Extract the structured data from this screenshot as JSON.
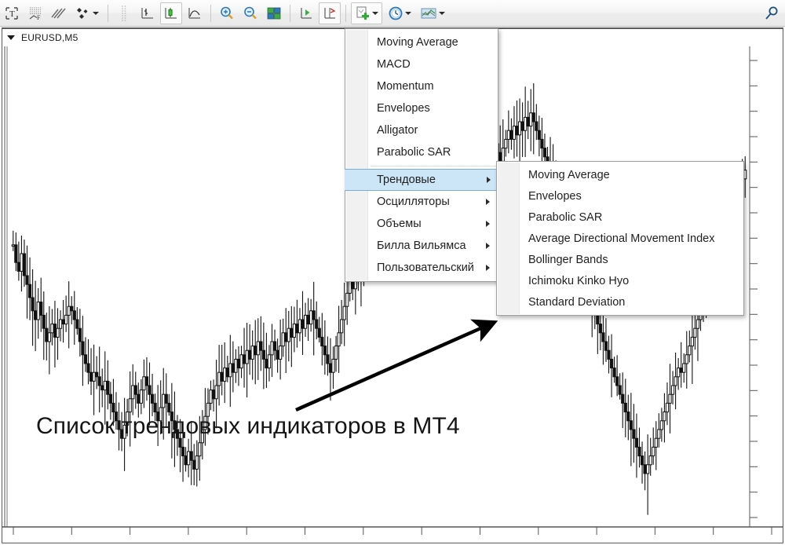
{
  "app": {
    "name": "MetaTrader 4",
    "accent": "#cde6f7",
    "accent_border": "#7aaed6",
    "toolbar_bg": "#eeeeee",
    "chart_bg": "#ffffff",
    "candle_color": "#111111"
  },
  "toolbar": {
    "groups": [
      {
        "name": "drawing-tools",
        "buttons": [
          {
            "icon": "crosshair-icon",
            "label": "Crosshair",
            "framed": false,
            "dropdown": false
          },
          {
            "icon": "fibonacci-icon",
            "label": "Fibonacci",
            "framed": false,
            "dropdown": false
          },
          {
            "icon": "trendline-channel-icon",
            "label": "Channels",
            "framed": false,
            "dropdown": false
          },
          {
            "icon": "shapes-icon",
            "label": "Shapes",
            "framed": false,
            "dropdown": true
          }
        ]
      },
      {
        "name": "chart-type-tools",
        "buttons": [
          {
            "icon": "bar-chart-icon",
            "label": "Bar Chart",
            "framed": false,
            "dropdown": false
          },
          {
            "icon": "candlestick-chart-icon",
            "label": "Candlesticks",
            "framed": true,
            "dropdown": false
          },
          {
            "icon": "line-chart-icon",
            "label": "Line Chart",
            "framed": false,
            "dropdown": false
          }
        ]
      },
      {
        "name": "zoom-tools",
        "buttons": [
          {
            "icon": "zoom-in-icon",
            "label": "Zoom In",
            "framed": false,
            "dropdown": false
          },
          {
            "icon": "zoom-out-icon",
            "label": "Zoom Out",
            "framed": false,
            "dropdown": false
          },
          {
            "icon": "tile-windows-icon",
            "label": "Tile Windows",
            "framed": false,
            "dropdown": false
          }
        ]
      },
      {
        "name": "scroll-tools",
        "buttons": [
          {
            "icon": "auto-scroll-icon",
            "label": "Auto Scroll",
            "framed": false,
            "dropdown": false
          },
          {
            "icon": "chart-shift-icon",
            "label": "Chart Shift",
            "framed": true,
            "dropdown": false
          }
        ]
      },
      {
        "name": "indicator-tools",
        "buttons": [
          {
            "icon": "add-indicator-icon",
            "label": "Indicators",
            "framed": true,
            "dropdown": true
          },
          {
            "icon": "timeframe-clock-icon",
            "label": "Periods",
            "framed": false,
            "dropdown": true
          },
          {
            "icon": "templates-icon",
            "label": "Templates",
            "framed": false,
            "dropdown": true
          }
        ]
      }
    ],
    "search_icon": "search-icon"
  },
  "chart": {
    "symbol_label": "EURUSD,M5",
    "dropdown_icon": "chevron-down-icon",
    "price_axis": {
      "ticks": 18
    },
    "time_axis": {
      "ticks": 13
    }
  },
  "annotation": {
    "text": "Список трендовых индикаторов в MT4",
    "arrow_icon": "arrow-pointer-icon"
  },
  "menus": {
    "indicators_menu": {
      "name": "indicators-dropdown",
      "items": [
        {
          "label": "Moving Average",
          "submenu": false,
          "highlighted": false,
          "separator_after": false
        },
        {
          "label": "MACD",
          "submenu": false,
          "highlighted": false,
          "separator_after": false
        },
        {
          "label": "Momentum",
          "submenu": false,
          "highlighted": false,
          "separator_after": false
        },
        {
          "label": "Envelopes",
          "submenu": false,
          "highlighted": false,
          "separator_after": false
        },
        {
          "label": "Alligator",
          "submenu": false,
          "highlighted": false,
          "separator_after": false
        },
        {
          "label": "Parabolic SAR",
          "submenu": false,
          "highlighted": false,
          "separator_after": true
        },
        {
          "label": "Трендовые",
          "submenu": true,
          "highlighted": true,
          "separator_after": false
        },
        {
          "label": "Осцилляторы",
          "submenu": true,
          "highlighted": false,
          "separator_after": false
        },
        {
          "label": "Объемы",
          "submenu": true,
          "highlighted": false,
          "separator_after": false
        },
        {
          "label": "Билла Вильямса",
          "submenu": true,
          "highlighted": false,
          "separator_after": false
        },
        {
          "label": "Пользовательский",
          "submenu": true,
          "highlighted": false,
          "separator_after": false
        }
      ]
    },
    "trend_submenu": {
      "name": "trend-indicators-submenu",
      "items": [
        {
          "label": "Moving Average"
        },
        {
          "label": "Envelopes"
        },
        {
          "label": "Parabolic SAR"
        },
        {
          "label": "Average Directional Movement Index"
        },
        {
          "label": "Bollinger Bands"
        },
        {
          "label": "Ichimoku Kinko Hyo"
        },
        {
          "label": "Standard Deviation"
        }
      ]
    }
  },
  "chart_data": {
    "type": "candlestick",
    "title": "EURUSD,M5",
    "xlabel": "",
    "ylabel": "",
    "grid": false,
    "legend": false,
    "series": [
      {
        "name": "EURUSD M5",
        "values": [
          62,
          58,
          56,
          60,
          55,
          53,
          50,
          47,
          45,
          49,
          46,
          43,
          40,
          42,
          44,
          41,
          43,
          45,
          44,
          46,
          48,
          47,
          45,
          43,
          40,
          37,
          35,
          33,
          31,
          33,
          32,
          30,
          29,
          31,
          28,
          26,
          24,
          22,
          20,
          18,
          21,
          24,
          27,
          30,
          28,
          26,
          29,
          32,
          30,
          28,
          26,
          24,
          22,
          25,
          28,
          26,
          24,
          22,
          20,
          18,
          16,
          14,
          12,
          15,
          13,
          11,
          14,
          17,
          20,
          23,
          26,
          29,
          27,
          30,
          33,
          31,
          34,
          32,
          35,
          33,
          36,
          34,
          37,
          35,
          38,
          36,
          39,
          37,
          40,
          38,
          36,
          34,
          37,
          40,
          38,
          36,
          39,
          42,
          40,
          43,
          41,
          44,
          42,
          45,
          43,
          46,
          44,
          47,
          45,
          43,
          41,
          39,
          37,
          35,
          33,
          36,
          39,
          42,
          45,
          48,
          51,
          54,
          52,
          55,
          58,
          56,
          59,
          62,
          60,
          63,
          66,
          64,
          67,
          70,
          68,
          71,
          74,
          72,
          75,
          73,
          76,
          74,
          77,
          75,
          78,
          76,
          79,
          77,
          80,
          78,
          81,
          79,
          82,
          80,
          83,
          81,
          84,
          82,
          85,
          83,
          86,
          84,
          87,
          85,
          88,
          86,
          84,
          82,
          85,
          83,
          86,
          84,
          87,
          85,
          83,
          81,
          84,
          86,
          88,
          86,
          89,
          87,
          90,
          88,
          91,
          89,
          92,
          90,
          88,
          86,
          84,
          82,
          80,
          78,
          76,
          74,
          72,
          70,
          68,
          66,
          64,
          62,
          60,
          58,
          56,
          54,
          52,
          50,
          48,
          46,
          44,
          42,
          40,
          38,
          36,
          34,
          32,
          30,
          28,
          26,
          24,
          22,
          20,
          18,
          16,
          14,
          12,
          10,
          12,
          14,
          16,
          18,
          20,
          22,
          24,
          26,
          28,
          30,
          32,
          34,
          33,
          35,
          37,
          39,
          41,
          43,
          45,
          47,
          49,
          51,
          53,
          55,
          57,
          59,
          61,
          63,
          65,
          67,
          69,
          71,
          73,
          75,
          77,
          79
        ]
      }
    ]
  }
}
